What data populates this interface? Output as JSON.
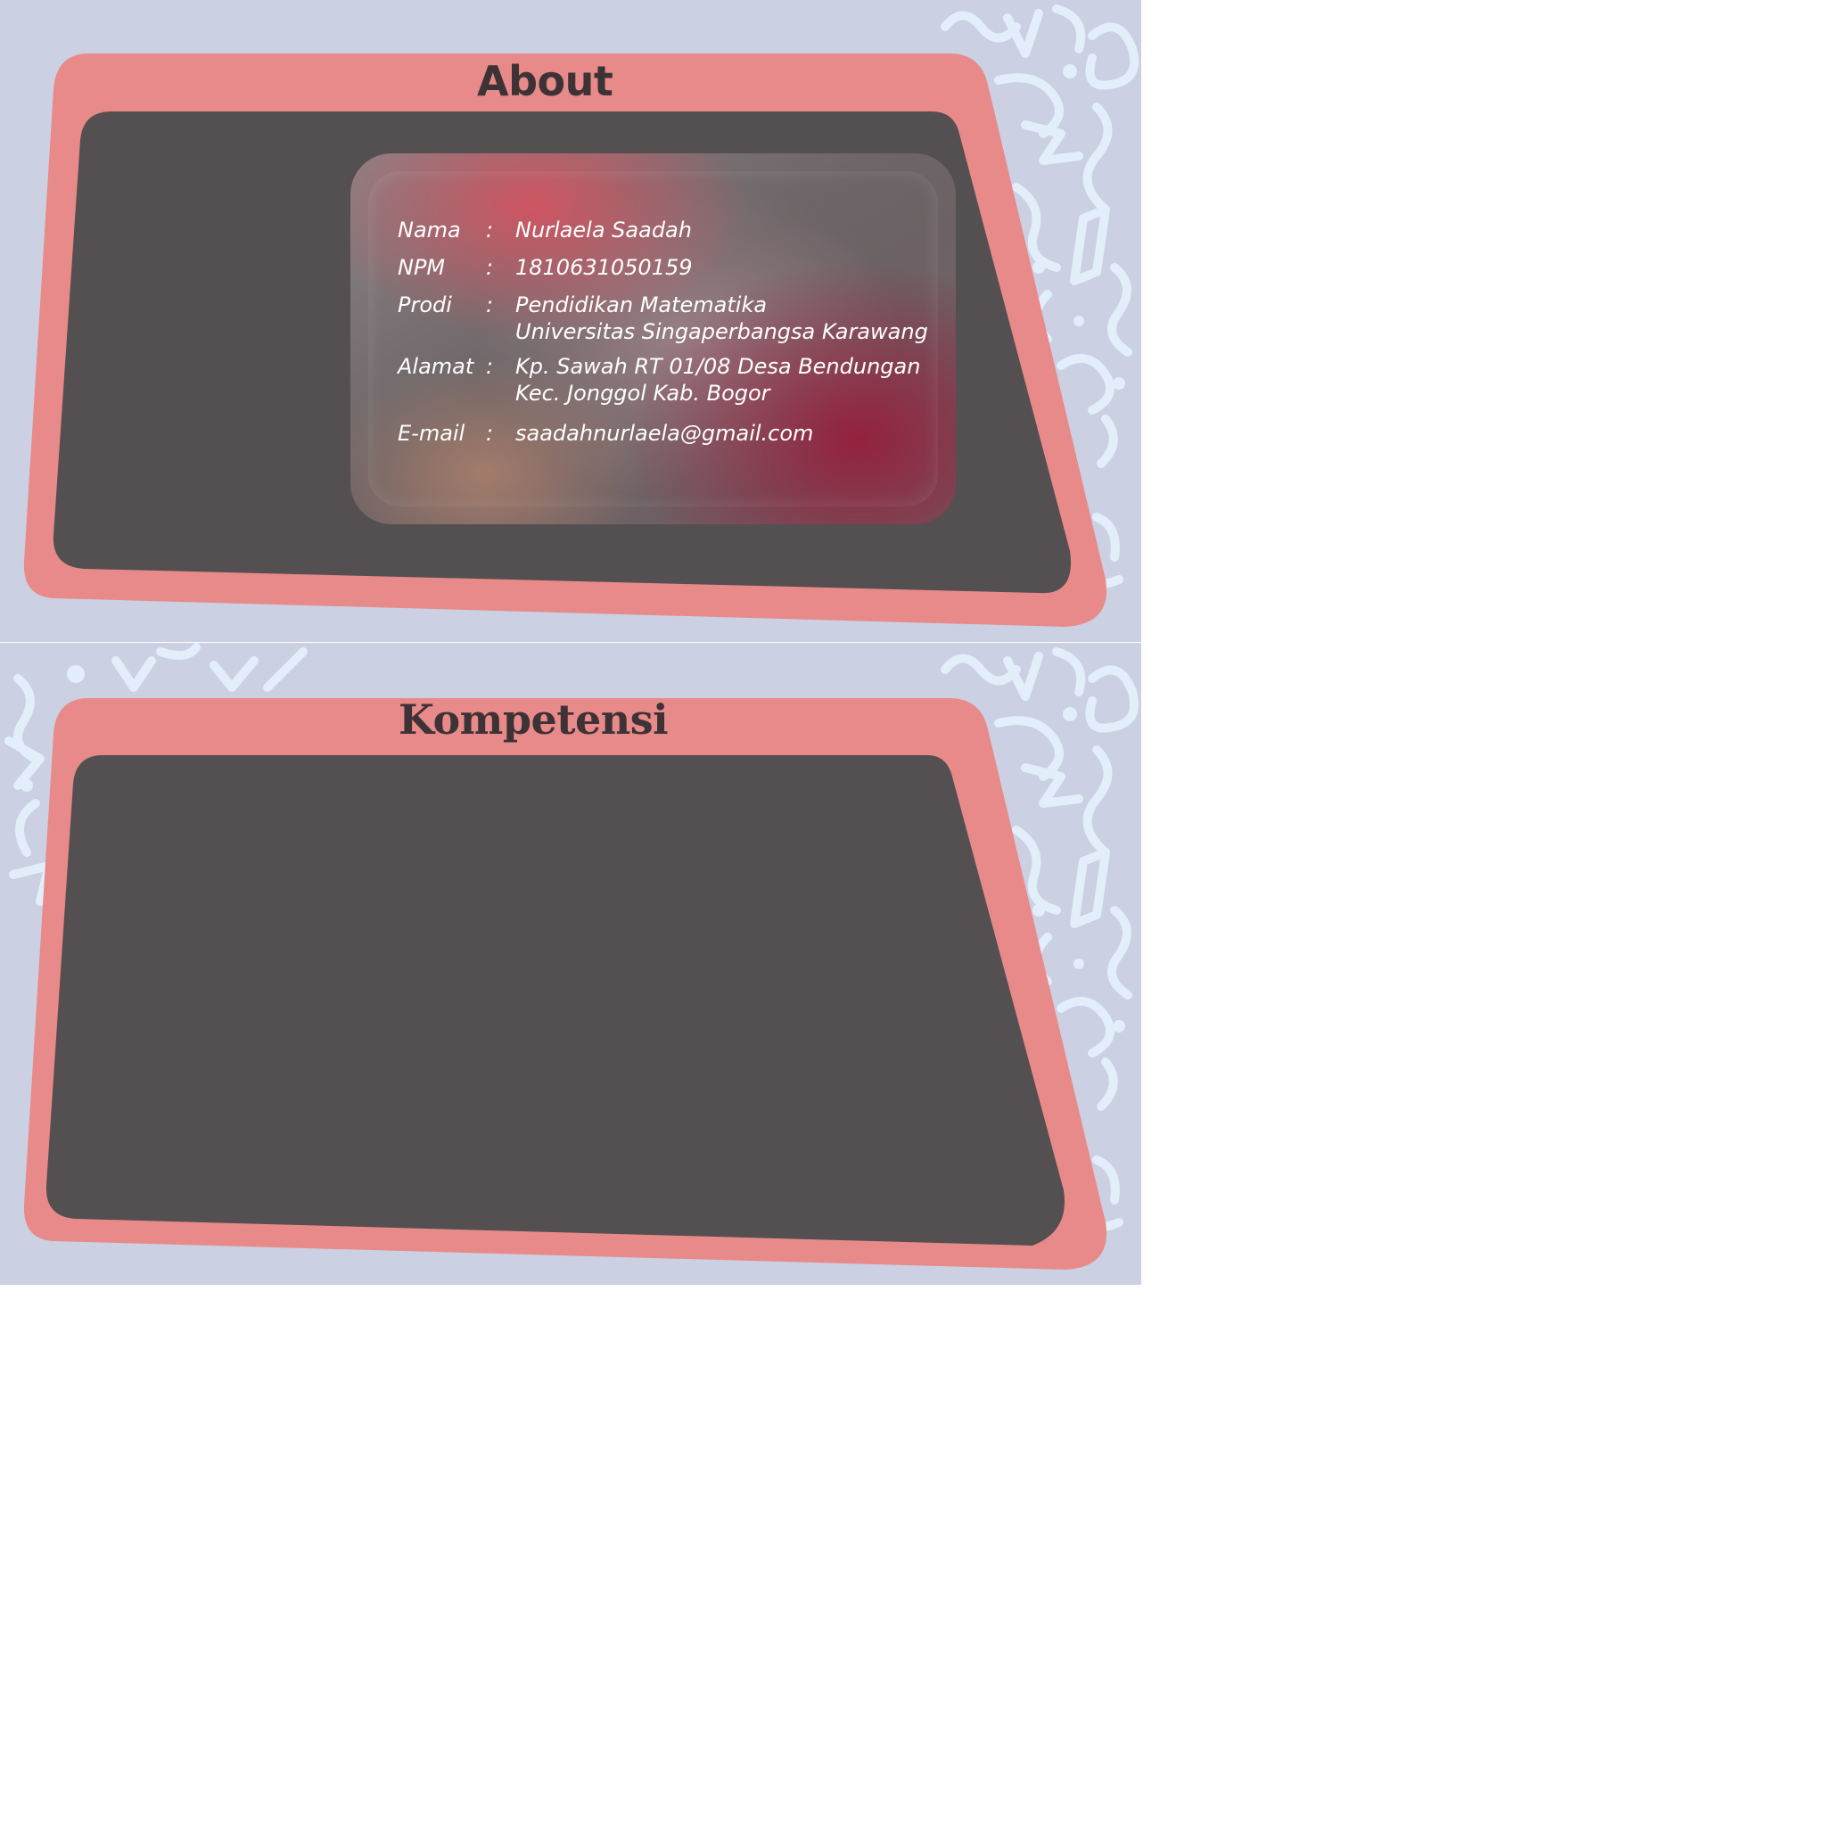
{
  "about": {
    "title": "About",
    "rows": [
      {
        "label": "Nama",
        "sep": ":",
        "value": "Nurlaela Saadah"
      },
      {
        "label": "NPM",
        "sep": ":",
        "value": "1810631050159"
      },
      {
        "label": "Prodi",
        "sep": ":",
        "value": "Pendidikan Matematika",
        "value2": "Universitas Singaperbangsa Karawang"
      },
      {
        "label": "Alamat",
        "sep": ":",
        "value": "Kp. Sawah RT 01/08 Desa Bendungan",
        "value2": "Kec. Jonggol Kab. Bogor"
      },
      {
        "label": "E-mail",
        "sep": ":",
        "value": "saadahnurlaela@gmail.com"
      }
    ]
  },
  "kompetensi": {
    "title": "Kompetensi"
  },
  "colors": {
    "background": "#cbd0e2",
    "frame": "#e88a89",
    "panel": "#544f50",
    "doodle": "#e3eefb",
    "title_text": "#3d3336"
  }
}
